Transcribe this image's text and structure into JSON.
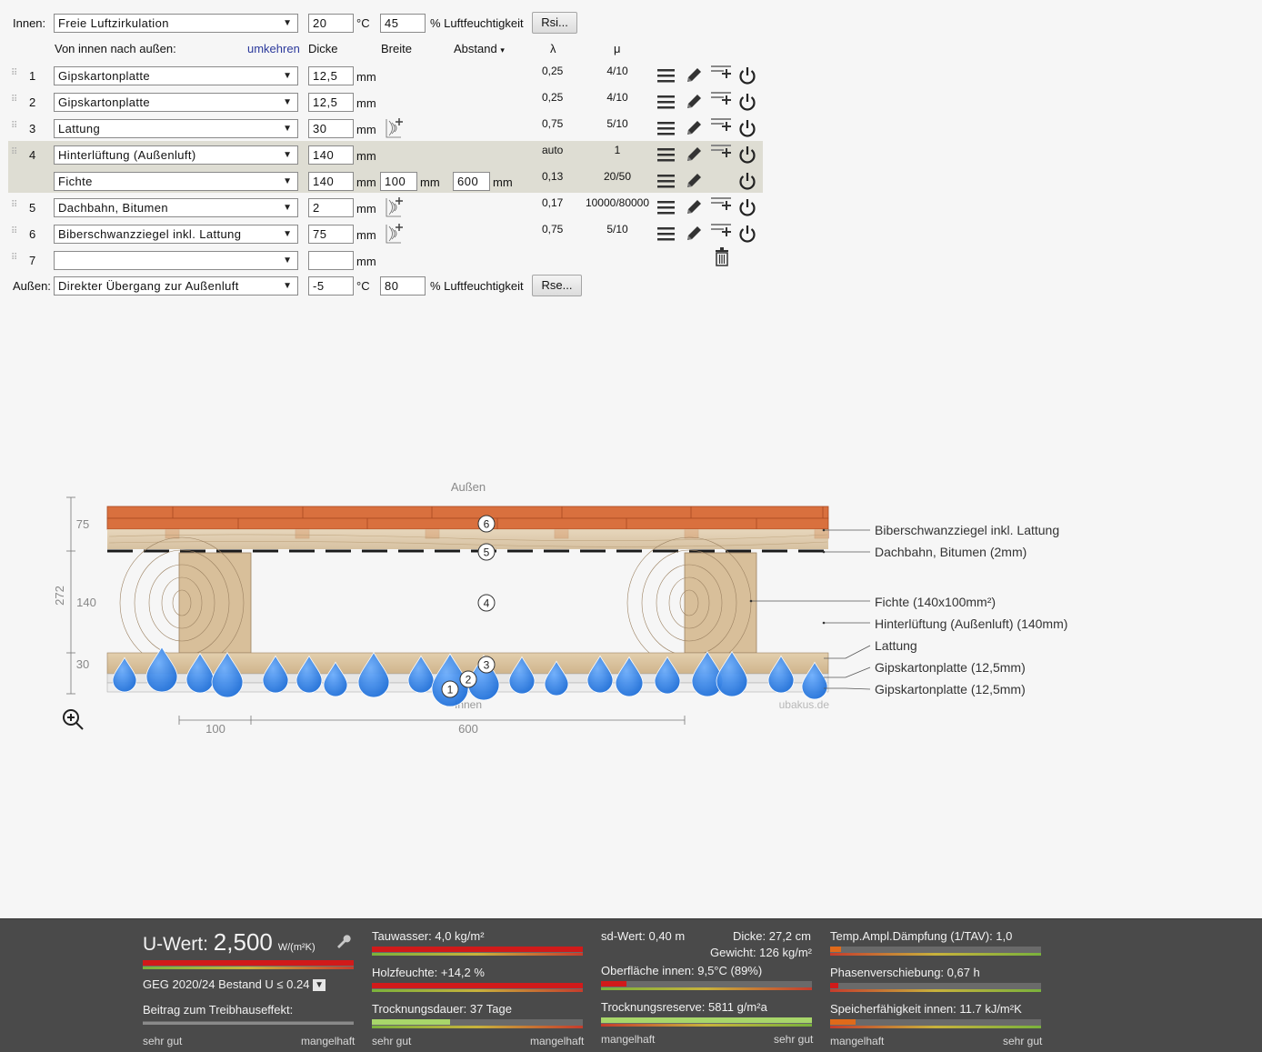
{
  "top": {
    "innen_label": "Innen:",
    "innen_select": "Freie Luftzirkulation",
    "innen_temp": "20",
    "temp_unit": "°C",
    "innen_humidity": "45",
    "humidity_label": "% Luftfeuchtigkeit",
    "rsi_button": "Rsi...",
    "aussen_label": "Außen:",
    "aussen_select": "Direkter Übergang zur Außenluft",
    "aussen_temp": "-5",
    "aussen_humidity": "80",
    "rse_button": "Rse..."
  },
  "header": {
    "direction": "Von innen nach außen:",
    "reverse_link": "umkehren",
    "dicke": "Dicke",
    "breite": "Breite",
    "abstand": "Abstand",
    "abstand_arrow": "▾",
    "lambda": "λ",
    "mu": "μ"
  },
  "units": {
    "mm": "mm"
  },
  "layers": [
    {
      "num": "1",
      "material": "Gipskartonplatte",
      "thickness": "12,5",
      "lambda": "0,25",
      "mu": "4/10"
    },
    {
      "num": "2",
      "material": "Gipskartonplatte",
      "thickness": "12,5",
      "lambda": "0,25",
      "mu": "4/10"
    },
    {
      "num": "3",
      "material": "Lattung",
      "thickness": "30",
      "lambda": "0,75",
      "mu": "5/10"
    },
    {
      "num": "4",
      "material": "Hinterlüftung (Außenluft)",
      "thickness": "140",
      "lambda": "auto",
      "mu": "1",
      "sub": {
        "material": "Fichte",
        "thickness": "140",
        "width": "100",
        "spacing": "600",
        "lambda": "0,13",
        "mu": "20/50"
      }
    },
    {
      "num": "5",
      "material": "Dachbahn, Bitumen",
      "thickness": "2",
      "lambda": "0,17",
      "mu": "10000/80000"
    },
    {
      "num": "6",
      "material": "Biberschwanzziegel inkl. Lattung",
      "thickness": "75",
      "lambda": "0,75",
      "mu": "5/10"
    },
    {
      "num": "7",
      "material": "",
      "thickness": ""
    }
  ],
  "drawing": {
    "top_label": "Außen",
    "bottom_label": "Innen",
    "watermark": "ubakus.de",
    "dim_total": "272",
    "dim_75": "75",
    "dim_140": "140",
    "dim_30": "30",
    "dim_100": "100",
    "dim_600": "600",
    "callouts": [
      "Biberschwanzziegel inkl. Lattung",
      "Dachbahn, Bitumen (2mm)",
      "Fichte (140x100mm²)",
      "Hinterlüftung (Außenluft) (140mm)",
      "Lattung",
      "Gipskartonplatte (12,5mm)",
      "Gipskartonplatte (12,5mm)"
    ],
    "markers": [
      "1",
      "2",
      "3",
      "4",
      "5",
      "6"
    ],
    "colors": {
      "tile": "#d9703e",
      "wood": "#d8bf9a",
      "bitumen": "#1a1a1a",
      "drop": "#2f7fe0"
    }
  },
  "results": {
    "uwert_label": "U-Wert:",
    "uwert_value": "2,500",
    "uwert_unit": "W/(m²K)",
    "geg": "GEG 2020/24 Bestand U ≤ 0.24",
    "treibhaus": "Beitrag zum Treibhauseffekt:",
    "sehr_gut": "sehr gut",
    "mangelhaft": "mangelhaft",
    "tauwasser": "Tauwasser: 4,0 kg/m²",
    "holzfeuchte": "Holzfeuchte: +14,2 %",
    "trocknungsdauer": "Trocknungsdauer: 37 Tage",
    "sd_wert": "sd-Wert: 0,40 m",
    "dicke": "Dicke: 27,2 cm",
    "gewicht": "Gewicht: 126 kg/m²",
    "oberflaeche": "Oberfläche innen: 9,5°C (89%)",
    "trocknungsreserve": "Trocknungsreserve: 5811 g/m²a",
    "temp_ampl": "Temp.Ampl.Dämpfung (1/TAV): 1,0",
    "phasen": "Phasenverschiebung: 0,67 h",
    "speicher": "Speicherfähigkeit innen: 11.7 kJ/m²K",
    "levels": {
      "uwert": 1.0,
      "tauwasser": 1.0,
      "holzfeuchte": 1.0,
      "trocknungsdauer": 0.37,
      "oberflaeche": 0.12,
      "trocknungsreserve": 1.0,
      "temp_ampl": 0.05,
      "phasen": 0.04,
      "speicher": 0.12
    }
  }
}
